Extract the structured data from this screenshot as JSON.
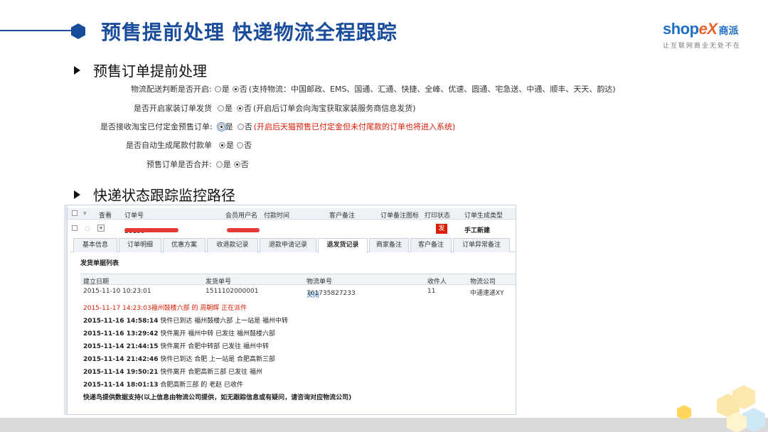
{
  "header": {
    "title": "预售提前处理 快递物流全程跟踪",
    "logo_word_a": "shop",
    "logo_word_b": "eX",
    "logo_cn": "商派",
    "logo_tagline": "让互联网商业无处不在"
  },
  "section1": {
    "heading": "预售订单提前处理",
    "settings": [
      {
        "label": "物流配送判断是否开启:",
        "options": [
          "是",
          "否"
        ],
        "selected": "否",
        "note": "(支持物流：中国邮政、EMS、国通、汇通、快捷、全峰、优速、圆通、宅急送、中通、顺丰、天天、韵达)"
      },
      {
        "label": "是否开启家装订单发货",
        "options": [
          "是",
          "否"
        ],
        "selected": "否",
        "note": "(开启后订单会向淘宝获取家装服务商信息发货)"
      },
      {
        "label": "是否接收淘宝已付定金预售订单:",
        "options": [
          "是",
          "否"
        ],
        "selected": "是",
        "note": "(开启后天猫预售已付定金但未付尾款的订单也将进入系统)"
      },
      {
        "label": "是否自动生成尾款付款单",
        "options": [
          "是",
          "否"
        ],
        "selected": "是",
        "note": ""
      },
      {
        "label": "预售订单是否合并:",
        "options": [
          "是",
          "否"
        ],
        "selected": "否",
        "note": ""
      }
    ]
  },
  "section2": {
    "heading": "快递状态跟踪监控路径"
  },
  "order_grid": {
    "columns": [
      "查看",
      "订单号",
      "会员用户名",
      "付款时间",
      "客户备注",
      "订单备注图标",
      "打印状态",
      "订单生成类型"
    ],
    "row": {
      "order_no": "20150",
      "print_status": "发",
      "gen_type": "手工新建"
    }
  },
  "tabs": [
    "基本信息",
    "订单明细",
    "优惠方案",
    "收退款记录",
    "退款申请记录",
    "退发货记录",
    "商家备注",
    "客户备注",
    "订单异常备注"
  ],
  "active_tab": "退发货记录",
  "shipping": {
    "title": "发货单据列表",
    "columns": [
      "建立日期",
      "发货单号",
      "物流单号",
      "收件人",
      "物流公司"
    ],
    "row": {
      "date": "2015-11-10 10:23:01",
      "delivery_no": "1511102000001",
      "tracking_no": "761735827233",
      "close_link": "关闭",
      "recipient": "11",
      "company": "中通速递XY"
    }
  },
  "tracking": [
    {
      "ts": "2015-11-17 14:23:03",
      "text": "福州鼓楼六部 的 周朝辉 正在派件",
      "highlight": true
    },
    {
      "ts": "2015-11-16 14:58:14",
      "text": "快件已到达 福州鼓楼六部 上一站是 福州中转",
      "highlight": false
    },
    {
      "ts": "2015-11-16 13:29:42",
      "text": "快件离开 福州中转 已发往 福州鼓楼六部",
      "highlight": false
    },
    {
      "ts": "2015-11-14 21:44:15",
      "text": "快件离开 合肥中转部 已发往 福州中转",
      "highlight": false
    },
    {
      "ts": "2015-11-14 21:42:46",
      "text": "快件已到达 合肥 上一站是 合肥高新三部",
      "highlight": false
    },
    {
      "ts": "2015-11-14 19:50:21",
      "text": "快件离开 合肥高新三部 已发往 福州",
      "highlight": false
    },
    {
      "ts": "2015-11-14 18:01:13",
      "text": "合肥高新三部 的 老赵 已收件",
      "highlight": false
    }
  ],
  "footer_note": "快递鸟提供数据支持(以上信息由物流公司提供，如无跟踪信息或有疑问，请咨询对应物流公司)",
  "colors": {
    "brand_blue": "#1a4c9c",
    "accent_red": "#d81e06",
    "logo_orange": "#e8632a"
  }
}
